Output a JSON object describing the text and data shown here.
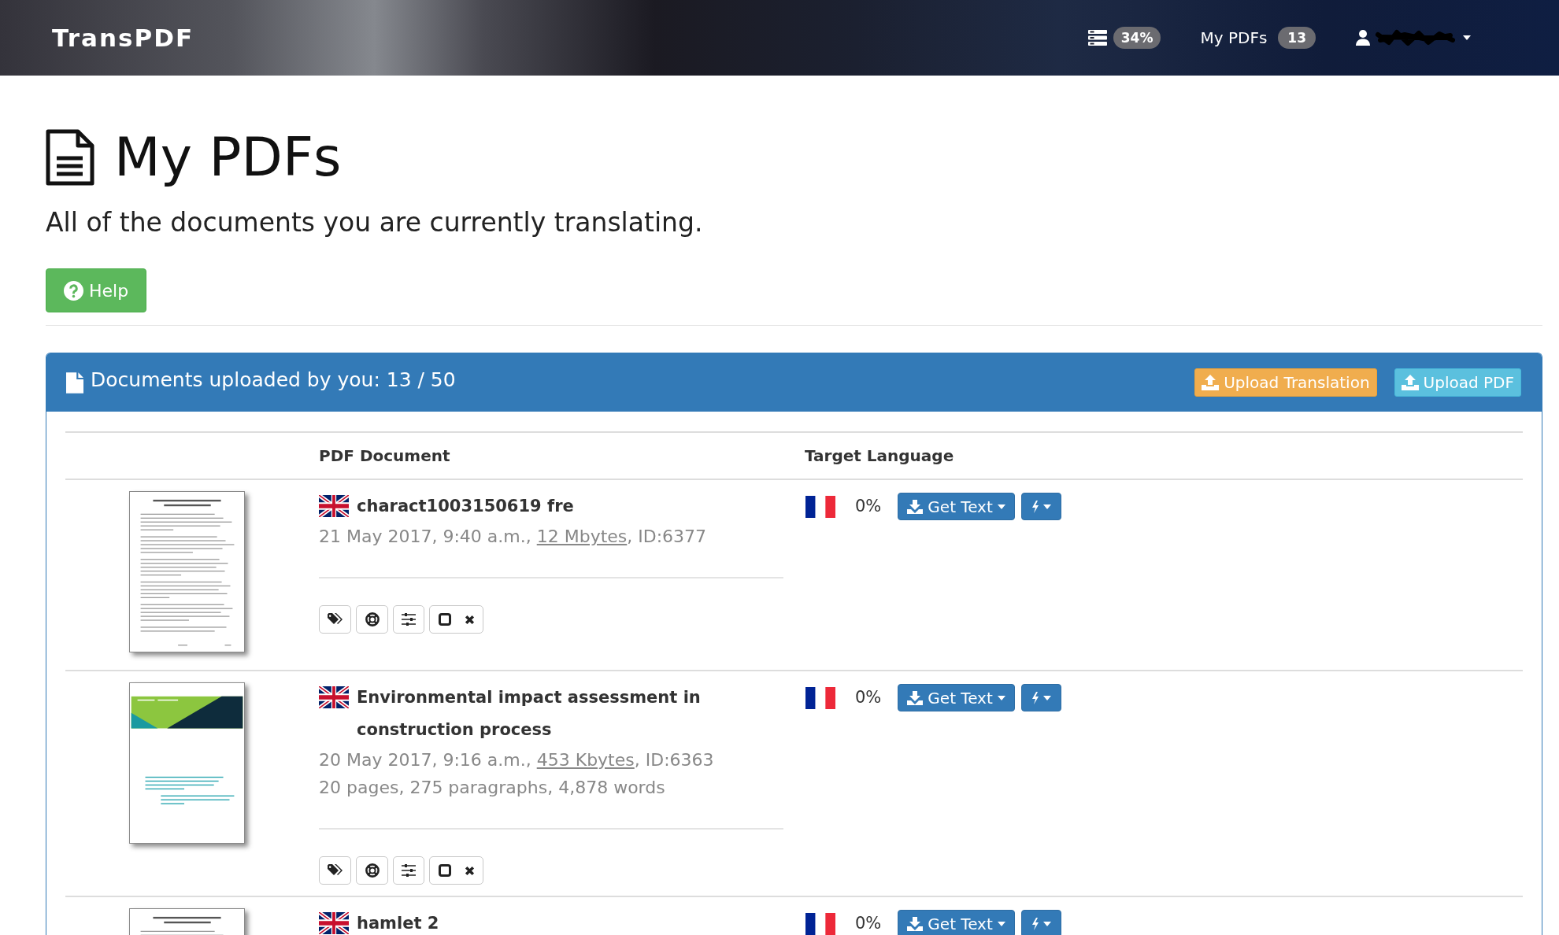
{
  "navbar": {
    "brand": "TransPDF",
    "queue_badge": "34%",
    "my_pdfs": {
      "label": "My PDFs",
      "count": "13"
    }
  },
  "header": {
    "title": "My PDFs",
    "subtitle": "All of the documents you are currently translating.",
    "help_button": "Help"
  },
  "panel": {
    "title": "Documents uploaded by you: 13 / 50",
    "buttons": [
      {
        "label": "Upload Translation",
        "kind": "warning"
      },
      {
        "label": "Upload PDF",
        "kind": "info"
      }
    ],
    "table": {
      "columns": [
        "PDF Document",
        "Target Language"
      ],
      "rows": [
        {
          "thumbnail": {
            "kind": "text"
          },
          "title": "charact1003150619 fre",
          "date": "21 May 2017, 9:40 a.m.,",
          "size": "12 Mbytes",
          "id": ", ID:6377",
          "checked": false,
          "progress": "0%",
          "action": "Get Text"
        },
        {
          "thumbnail": {
            "kind": "cover"
          },
          "title": "Environmental impact assessment in construction process",
          "date": "20 May 2017, 9:16 a.m.,",
          "size": "453 Kbytes",
          "id": ", ID:6363",
          "stats": "20 pages, 275 paragraphs, 4,878 words",
          "checked": false,
          "progress": "0%",
          "action": "Get Text"
        },
        {
          "thumbnail": {
            "kind": "text"
          },
          "title": "hamlet 2",
          "progress": "0%",
          "action": "Get Text"
        }
      ]
    }
  }
}
